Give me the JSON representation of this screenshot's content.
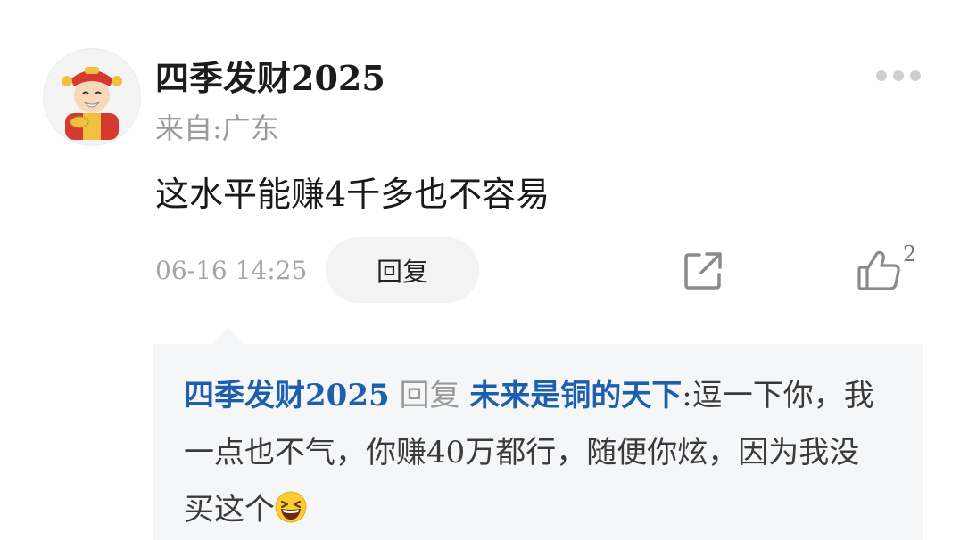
{
  "comment": {
    "username": "四季发财2025",
    "location": "来自:广东",
    "text": "这水平能赚4千多也不容易",
    "timestamp": "06-16 14:25",
    "reply_label": "回复",
    "like_count": "2"
  },
  "reply": {
    "author": "四季发财2025",
    "action": "回复",
    "target": "未来是铜的天下",
    "text": ":逗一下你，我一点也不气，你赚40万都行，随便你炫，因为我没买这个"
  },
  "icons": {
    "more": "more-dots-icon",
    "share": "share-icon",
    "like": "thumbs-up-icon",
    "emoji": "grinning-squinting-emoji-icon"
  },
  "colors": {
    "link": "#1d5fad",
    "reply_background": "#f5f6f8",
    "muted_text": "#9a9a9a"
  }
}
